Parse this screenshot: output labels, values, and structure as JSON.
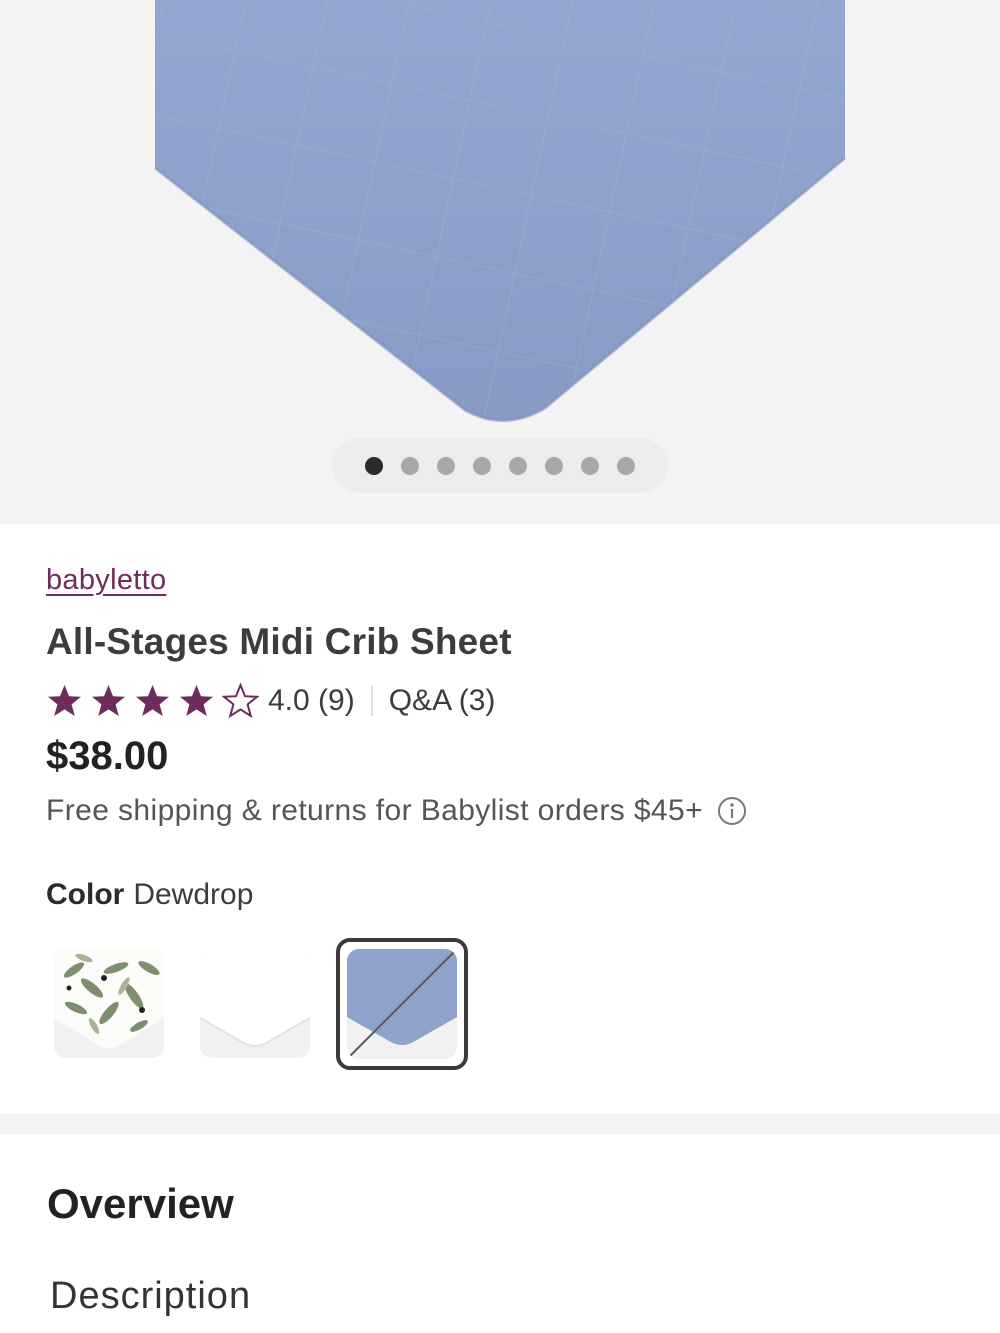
{
  "gallery": {
    "image_count": 8,
    "active_index": 0
  },
  "product": {
    "brand": "babyletto",
    "title": "All-Stages Midi Crib Sheet",
    "rating_text": "4.0 (9)",
    "rating_value": 4.0,
    "rating_max": 5,
    "qa_text": "Q&A (3)",
    "price": "$38.00",
    "shipping_text": "Free shipping & returns for Babylist orders $45+"
  },
  "color": {
    "label": "Color",
    "selected": "Dewdrop",
    "swatches": [
      {
        "name": "olive-leaf-swatch",
        "selected": false,
        "available": true
      },
      {
        "name": "white-swatch",
        "selected": false,
        "available": true
      },
      {
        "name": "dewdrop-swatch",
        "selected": true,
        "available": false
      }
    ]
  },
  "sections": {
    "overview": "Overview",
    "description": "Description"
  },
  "colors": {
    "brand": "#6e2c5c",
    "sheet_blue": "#8ea2cc"
  }
}
